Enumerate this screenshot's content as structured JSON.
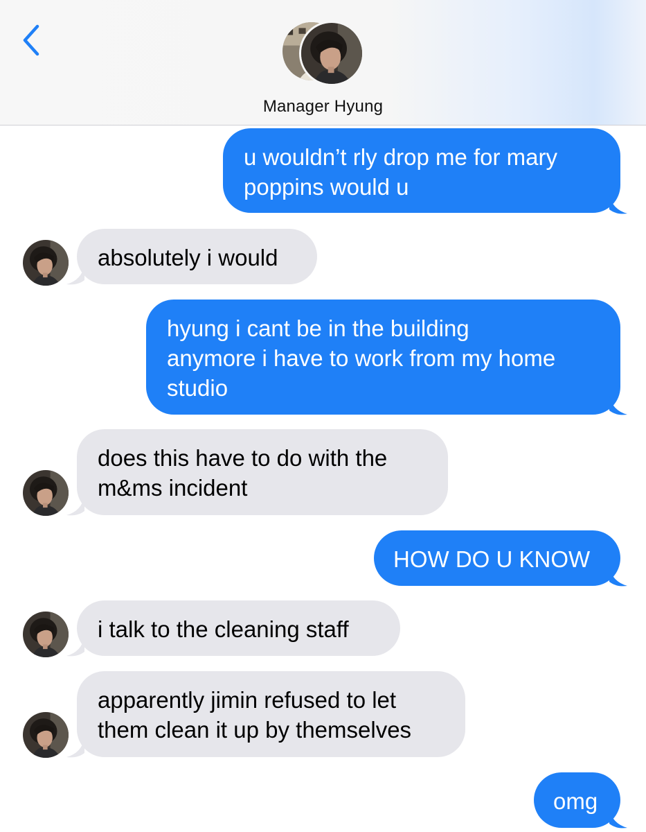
{
  "header": {
    "contact_name": "Manager Hyung",
    "back_icon": "chevron-left-icon"
  },
  "colors": {
    "sent_bubble": "#1f80f7",
    "received_bubble": "#e6e6eb",
    "back_icon": "#1f80f7"
  },
  "messages": [
    {
      "direction": "sent",
      "text": "u wouldn’t rly drop me for mary poppins would u",
      "lines": [
        "u wouldn’t rly drop me for mary",
        "poppins would u"
      ]
    },
    {
      "direction": "received",
      "text": "absolutely i would",
      "lines": [
        "absolutely i would"
      ]
    },
    {
      "direction": "sent",
      "text": "hyung i cant be in the building anymore i have to work from my home studio",
      "lines": [
        "hyung i cant be in the building",
        "anymore i have to work from my home",
        "studio"
      ]
    },
    {
      "direction": "received",
      "text": "does this have to do with the m&ms incident",
      "lines": [
        "does this have to do with the",
        "m&ms incident"
      ]
    },
    {
      "direction": "sent",
      "text": "HOW DO U KNOW",
      "lines": [
        "HOW DO U KNOW"
      ]
    },
    {
      "direction": "received",
      "text": "i talk to the cleaning staff",
      "lines": [
        "i talk to the cleaning staff"
      ]
    },
    {
      "direction": "received",
      "text": "apparently jimin refused to let them clean it up by themselves",
      "lines": [
        "apparently jimin refused to let",
        "them clean it up by themselves"
      ]
    },
    {
      "direction": "sent",
      "text": "omg",
      "lines": [
        "omg"
      ]
    }
  ]
}
